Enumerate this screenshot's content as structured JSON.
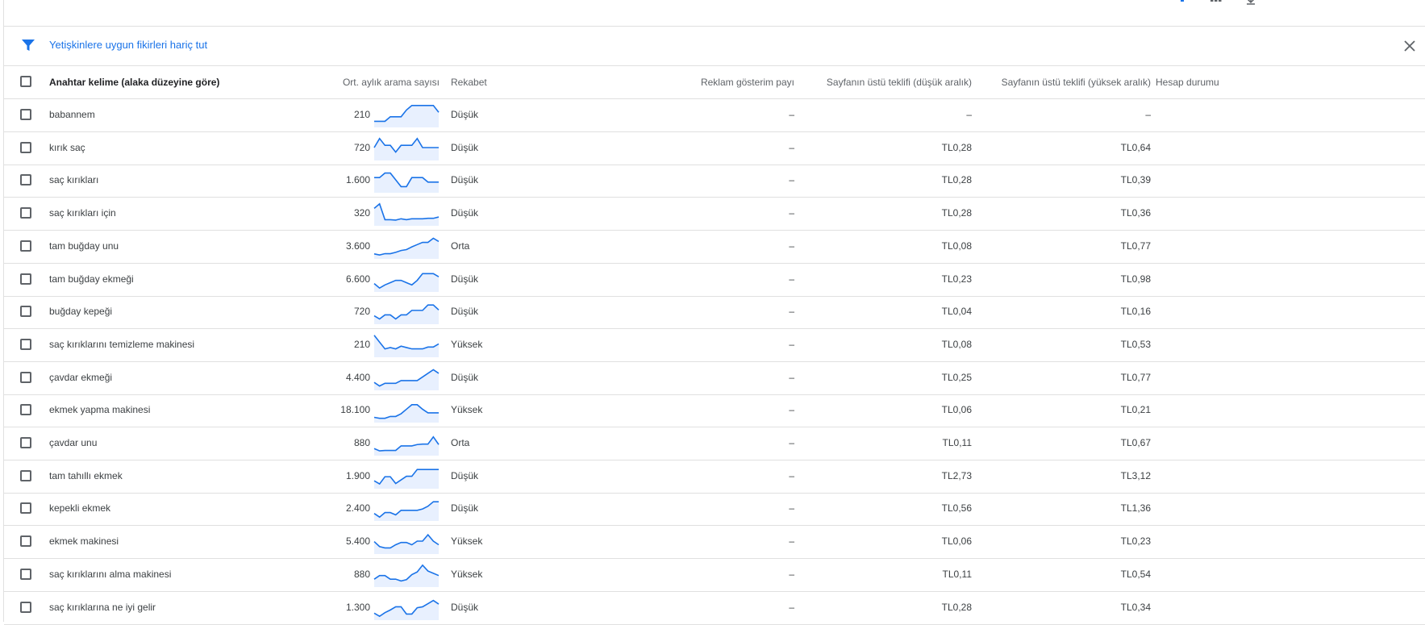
{
  "toolbar": {
    "icons": [
      "download-icon",
      "columns-icon",
      "expand-icon"
    ],
    "accent_color": "#1a73e8"
  },
  "filter": {
    "text": "Yetişkinlere uygun fikirleri hariç tut",
    "icon": "filter-icon",
    "close_icon": "close-icon"
  },
  "table": {
    "headers": {
      "keyword": "Anahtar kelime (alaka düzeyine göre)",
      "avg_searches": "Ort. aylık arama sayısı",
      "competition": "Rekabet",
      "impression_share": "Reklam gösterim payı",
      "bid_low": "Sayfanın üstü teklifi (düşük aralık)",
      "bid_high": "Sayfanın üstü teklifi (yüksek aralık)",
      "account_status": "Hesap durumu"
    },
    "rows": [
      {
        "keyword": "babannem",
        "searches": "210",
        "trend": [
          2,
          2,
          2,
          4,
          4,
          4,
          7,
          9,
          9,
          9,
          9,
          9,
          6
        ],
        "competition": "Düşük",
        "share": "–",
        "bid_low": "–",
        "bid_high": "–"
      },
      {
        "keyword": "kırık saç",
        "searches": "720",
        "trend": [
          5,
          9,
          6,
          6,
          3,
          6,
          6,
          6,
          9,
          5,
          5,
          5,
          5
        ],
        "competition": "Düşük",
        "share": "–",
        "bid_low": "TL0,28",
        "bid_high": "TL0,64"
      },
      {
        "keyword": "saç kırıkları",
        "searches": "1.600",
        "trend": [
          6,
          6,
          8,
          8,
          5,
          2,
          2,
          6,
          6,
          6,
          4,
          4,
          4
        ],
        "competition": "Düşük",
        "share": "–",
        "bid_low": "TL0,28",
        "bid_high": "TL0,39"
      },
      {
        "keyword": "saç kırıkları için",
        "searches": "320",
        "trend": [
          7,
          9,
          2,
          2,
          1.8,
          2.4,
          2,
          2.4,
          2.4,
          2.4,
          2.6,
          2.6,
          3.2
        ],
        "competition": "Düşük",
        "share": "–",
        "bid_low": "TL0,28",
        "bid_high": "TL0,36"
      },
      {
        "keyword": "tam buğday unu",
        "searches": "3.600",
        "trend": [
          1.5,
          1,
          1.6,
          1.6,
          2.2,
          3,
          3.4,
          4.6,
          5.6,
          6.6,
          6.6,
          8.4,
          7
        ],
        "competition": "Orta",
        "share": "–",
        "bid_low": "TL0,08",
        "bid_high": "TL0,77"
      },
      {
        "keyword": "tam buğday ekmeği",
        "searches": "6.600",
        "trend": [
          3,
          1,
          2.4,
          3.4,
          4.4,
          4.4,
          3.4,
          2.4,
          4.4,
          7.4,
          7.4,
          7.4,
          6
        ],
        "competition": "Düşük",
        "share": "–",
        "bid_low": "TL0,23",
        "bid_high": "TL0,98"
      },
      {
        "keyword": "buğday kepeği",
        "searches": "720",
        "trend": [
          3,
          1.6,
          3.4,
          3.4,
          1.6,
          3.4,
          3.4,
          5.4,
          5.4,
          5.4,
          7.8,
          7.8,
          5.6
        ],
        "competition": "Düşük",
        "share": "–",
        "bid_low": "TL0,04",
        "bid_high": "TL0,16"
      },
      {
        "keyword": "saç kırıklarını temizleme makinesi",
        "searches": "210",
        "trend": [
          9,
          6,
          3,
          3.6,
          3,
          4.2,
          3.6,
          3,
          3,
          3,
          3.8,
          3.8,
          5.2
        ],
        "competition": "Yüksek",
        "share": "–",
        "bid_low": "TL0,08",
        "bid_high": "TL0,53"
      },
      {
        "keyword": "çavdar ekmeği",
        "searches": "4.400",
        "trend": [
          2.8,
          1.2,
          2.4,
          2.4,
          2.4,
          3.6,
          3.6,
          3.6,
          3.6,
          5.2,
          6.8,
          8.4,
          6.8
        ],
        "competition": "Düşük",
        "share": "–",
        "bid_low": "TL0,25",
        "bid_high": "TL0,77"
      },
      {
        "keyword": "ekmek yapma makinesi",
        "searches": "18.100",
        "trend": [
          1.6,
          1.2,
          1.2,
          2,
          2,
          3.2,
          5.2,
          7.2,
          7.2,
          5.2,
          3.6,
          3.6,
          3.6
        ],
        "competition": "Yüksek",
        "share": "–",
        "bid_low": "TL0,06",
        "bid_high": "TL0,21"
      },
      {
        "keyword": "çavdar unu",
        "searches": "880",
        "trend": [
          2.4,
          1.4,
          1.6,
          1.6,
          1.6,
          3.6,
          3.6,
          3.6,
          4.2,
          4.4,
          4.4,
          7.6,
          4.2
        ],
        "competition": "Orta",
        "share": "–",
        "bid_low": "TL0,11",
        "bid_high": "TL0,67"
      },
      {
        "keyword": "tam tahıllı ekmek",
        "searches": "1.900",
        "trend": [
          2.8,
          1.4,
          4.6,
          4.6,
          1.6,
          3.2,
          4.8,
          4.8,
          7.8,
          7.8,
          7.8,
          7.8,
          7.8
        ],
        "competition": "Düşük",
        "share": "–",
        "bid_low": "TL2,73",
        "bid_high": "TL3,12"
      },
      {
        "keyword": "kepekli ekmek",
        "searches": "2.400",
        "trend": [
          2.6,
          1,
          3,
          3,
          2,
          4,
          4,
          4,
          4,
          4.6,
          5.8,
          7.8,
          7.8
        ],
        "competition": "Düşük",
        "share": "–",
        "bid_low": "TL0,56",
        "bid_high": "TL1,36"
      },
      {
        "keyword": "ekmek makinesi",
        "searches": "5.400",
        "trend": [
          4.8,
          2.6,
          2,
          2,
          3.4,
          4.4,
          4.4,
          3.4,
          5,
          5,
          7.8,
          5,
          3.4
        ],
        "competition": "Yüksek",
        "share": "–",
        "bid_low": "TL0,06",
        "bid_high": "TL0,23"
      },
      {
        "keyword": "saç kırıklarını alma makinesi",
        "searches": "880",
        "trend": [
          2.8,
          4.4,
          4.4,
          2.8,
          2.8,
          2,
          2.6,
          4.8,
          6,
          9,
          6.4,
          5.4,
          4.4
        ],
        "competition": "Yüksek",
        "share": "–",
        "bid_low": "TL0,11",
        "bid_high": "TL0,54"
      },
      {
        "keyword": "saç kırıklarına ne iyi gelir",
        "searches": "1.300",
        "trend": [
          2.4,
          1,
          2.6,
          3.8,
          5.2,
          5.2,
          2,
          2,
          4.8,
          5.2,
          6.6,
          8,
          6.4
        ],
        "competition": "Düşük",
        "share": "–",
        "bid_low": "TL0,28",
        "bid_high": "TL0,34"
      }
    ]
  }
}
